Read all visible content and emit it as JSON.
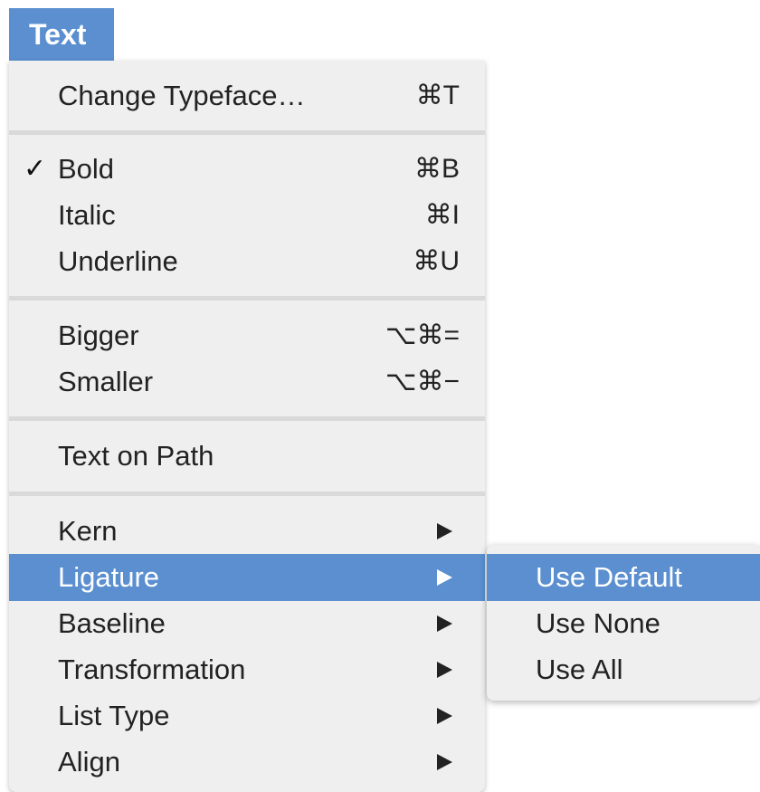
{
  "menubar": {
    "title": "Text"
  },
  "menu": {
    "items": [
      {
        "label": "Change Typeface…",
        "shortcut": "⌘T",
        "checked": false,
        "submenu": false
      },
      {
        "label": "Bold",
        "shortcut": "⌘B",
        "checked": true,
        "submenu": false
      },
      {
        "label": "Italic",
        "shortcut": "⌘I",
        "checked": false,
        "submenu": false
      },
      {
        "label": "Underline",
        "shortcut": "⌘U",
        "checked": false,
        "submenu": false
      },
      {
        "label": "Bigger",
        "shortcut": "⌥⌘=",
        "checked": false,
        "submenu": false
      },
      {
        "label": "Smaller",
        "shortcut": "⌥⌘−",
        "checked": false,
        "submenu": false
      },
      {
        "label": "Text on Path",
        "shortcut": "",
        "checked": false,
        "submenu": false
      },
      {
        "label": "Kern",
        "shortcut": "",
        "checked": false,
        "submenu": true
      },
      {
        "label": "Ligature",
        "shortcut": "",
        "checked": false,
        "submenu": true,
        "highlighted": true
      },
      {
        "label": "Baseline",
        "shortcut": "",
        "checked": false,
        "submenu": true
      },
      {
        "label": "Transformation",
        "shortcut": "",
        "checked": false,
        "submenu": true
      },
      {
        "label": "List Type",
        "shortcut": "",
        "checked": false,
        "submenu": true
      },
      {
        "label": "Align",
        "shortcut": "",
        "checked": false,
        "submenu": true
      }
    ],
    "check_glyph": "✓"
  },
  "submenu": {
    "parent": "Ligature",
    "items": [
      {
        "label": "Use Default",
        "highlighted": true
      },
      {
        "label": "Use None",
        "highlighted": false
      },
      {
        "label": "Use All",
        "highlighted": false
      }
    ]
  },
  "colors": {
    "highlight": "#5b8fd0",
    "menu_bg": "#efefef",
    "separator": "#d9d9d9"
  }
}
